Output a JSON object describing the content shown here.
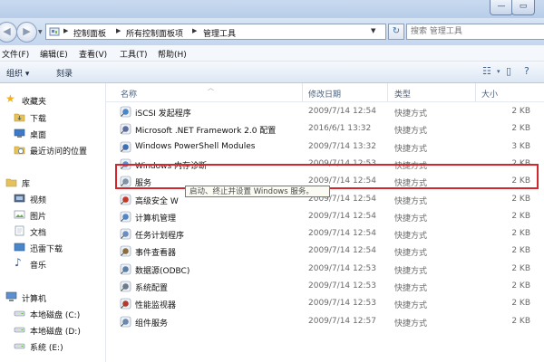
{
  "window": {
    "minimize_glyph": "—",
    "maximize_glyph": "▭"
  },
  "address": {
    "crumbs": [
      "控制面板",
      "所有控制面板项",
      "管理工具"
    ],
    "search_placeholder": "搜索 管理工具"
  },
  "menu": [
    "文件(F)",
    "编辑(E)",
    "查看(V)",
    "工具(T)",
    "帮助(H)"
  ],
  "toolbar": {
    "organize": "组织 ▾",
    "burn": "刻录"
  },
  "nav": {
    "favorites": "收藏夹",
    "favorites_items": [
      "下载",
      "桌面",
      "最近访问的位置"
    ],
    "libraries": "库",
    "library_items": [
      "视频",
      "图片",
      "文档",
      "迅雷下载",
      "音乐"
    ],
    "computer": "计算机",
    "drives": [
      "本地磁盘 (C:)",
      "本地磁盘 (D:)",
      "系统 (E:)"
    ]
  },
  "columns": {
    "name": "名称",
    "date": "修改日期",
    "type": "类型",
    "size": "大小"
  },
  "files": [
    {
      "name": "iSCSI 发起程序",
      "date": "2009/7/14 12:54",
      "type": "快捷方式",
      "size": "2 KB"
    },
    {
      "name": "Microsoft .NET Framework 2.0 配置",
      "date": "2016/6/1 13:32",
      "type": "快捷方式",
      "size": "2 KB"
    },
    {
      "name": "Windows PowerShell Modules",
      "date": "2009/7/14 13:32",
      "type": "快捷方式",
      "size": "3 KB"
    },
    {
      "name": "Windows 内存诊断",
      "date": "2009/7/14 12:53",
      "type": "快捷方式",
      "size": "2 KB"
    },
    {
      "name": "服务",
      "date": "2009/7/14 12:54",
      "type": "快捷方式",
      "size": "2 KB"
    },
    {
      "name": "高级安全 W",
      "date": "2009/7/14 12:54",
      "type": "快捷方式",
      "size": "2 KB"
    },
    {
      "name": "计算机管理",
      "date": "2009/7/14 12:54",
      "type": "快捷方式",
      "size": "2 KB"
    },
    {
      "name": "任务计划程序",
      "date": "2009/7/14 12:54",
      "type": "快捷方式",
      "size": "2 KB"
    },
    {
      "name": "事件查看器",
      "date": "2009/7/14 12:54",
      "type": "快捷方式",
      "size": "2 KB"
    },
    {
      "name": "数据源(ODBC)",
      "date": "2009/7/14 12:53",
      "type": "快捷方式",
      "size": "2 KB"
    },
    {
      "name": "系统配置",
      "date": "2009/7/14 12:53",
      "type": "快捷方式",
      "size": "2 KB"
    },
    {
      "name": "性能监视器",
      "date": "2009/7/14 12:53",
      "type": "快捷方式",
      "size": "2 KB"
    },
    {
      "name": "组件服务",
      "date": "2009/7/14 12:57",
      "type": "快捷方式",
      "size": "2 KB"
    }
  ],
  "tooltip": "启动、终止并设置 Windows 服务。",
  "colors": {
    "highlight_border": "#d2272d",
    "title_bar": "#c9daf0"
  }
}
